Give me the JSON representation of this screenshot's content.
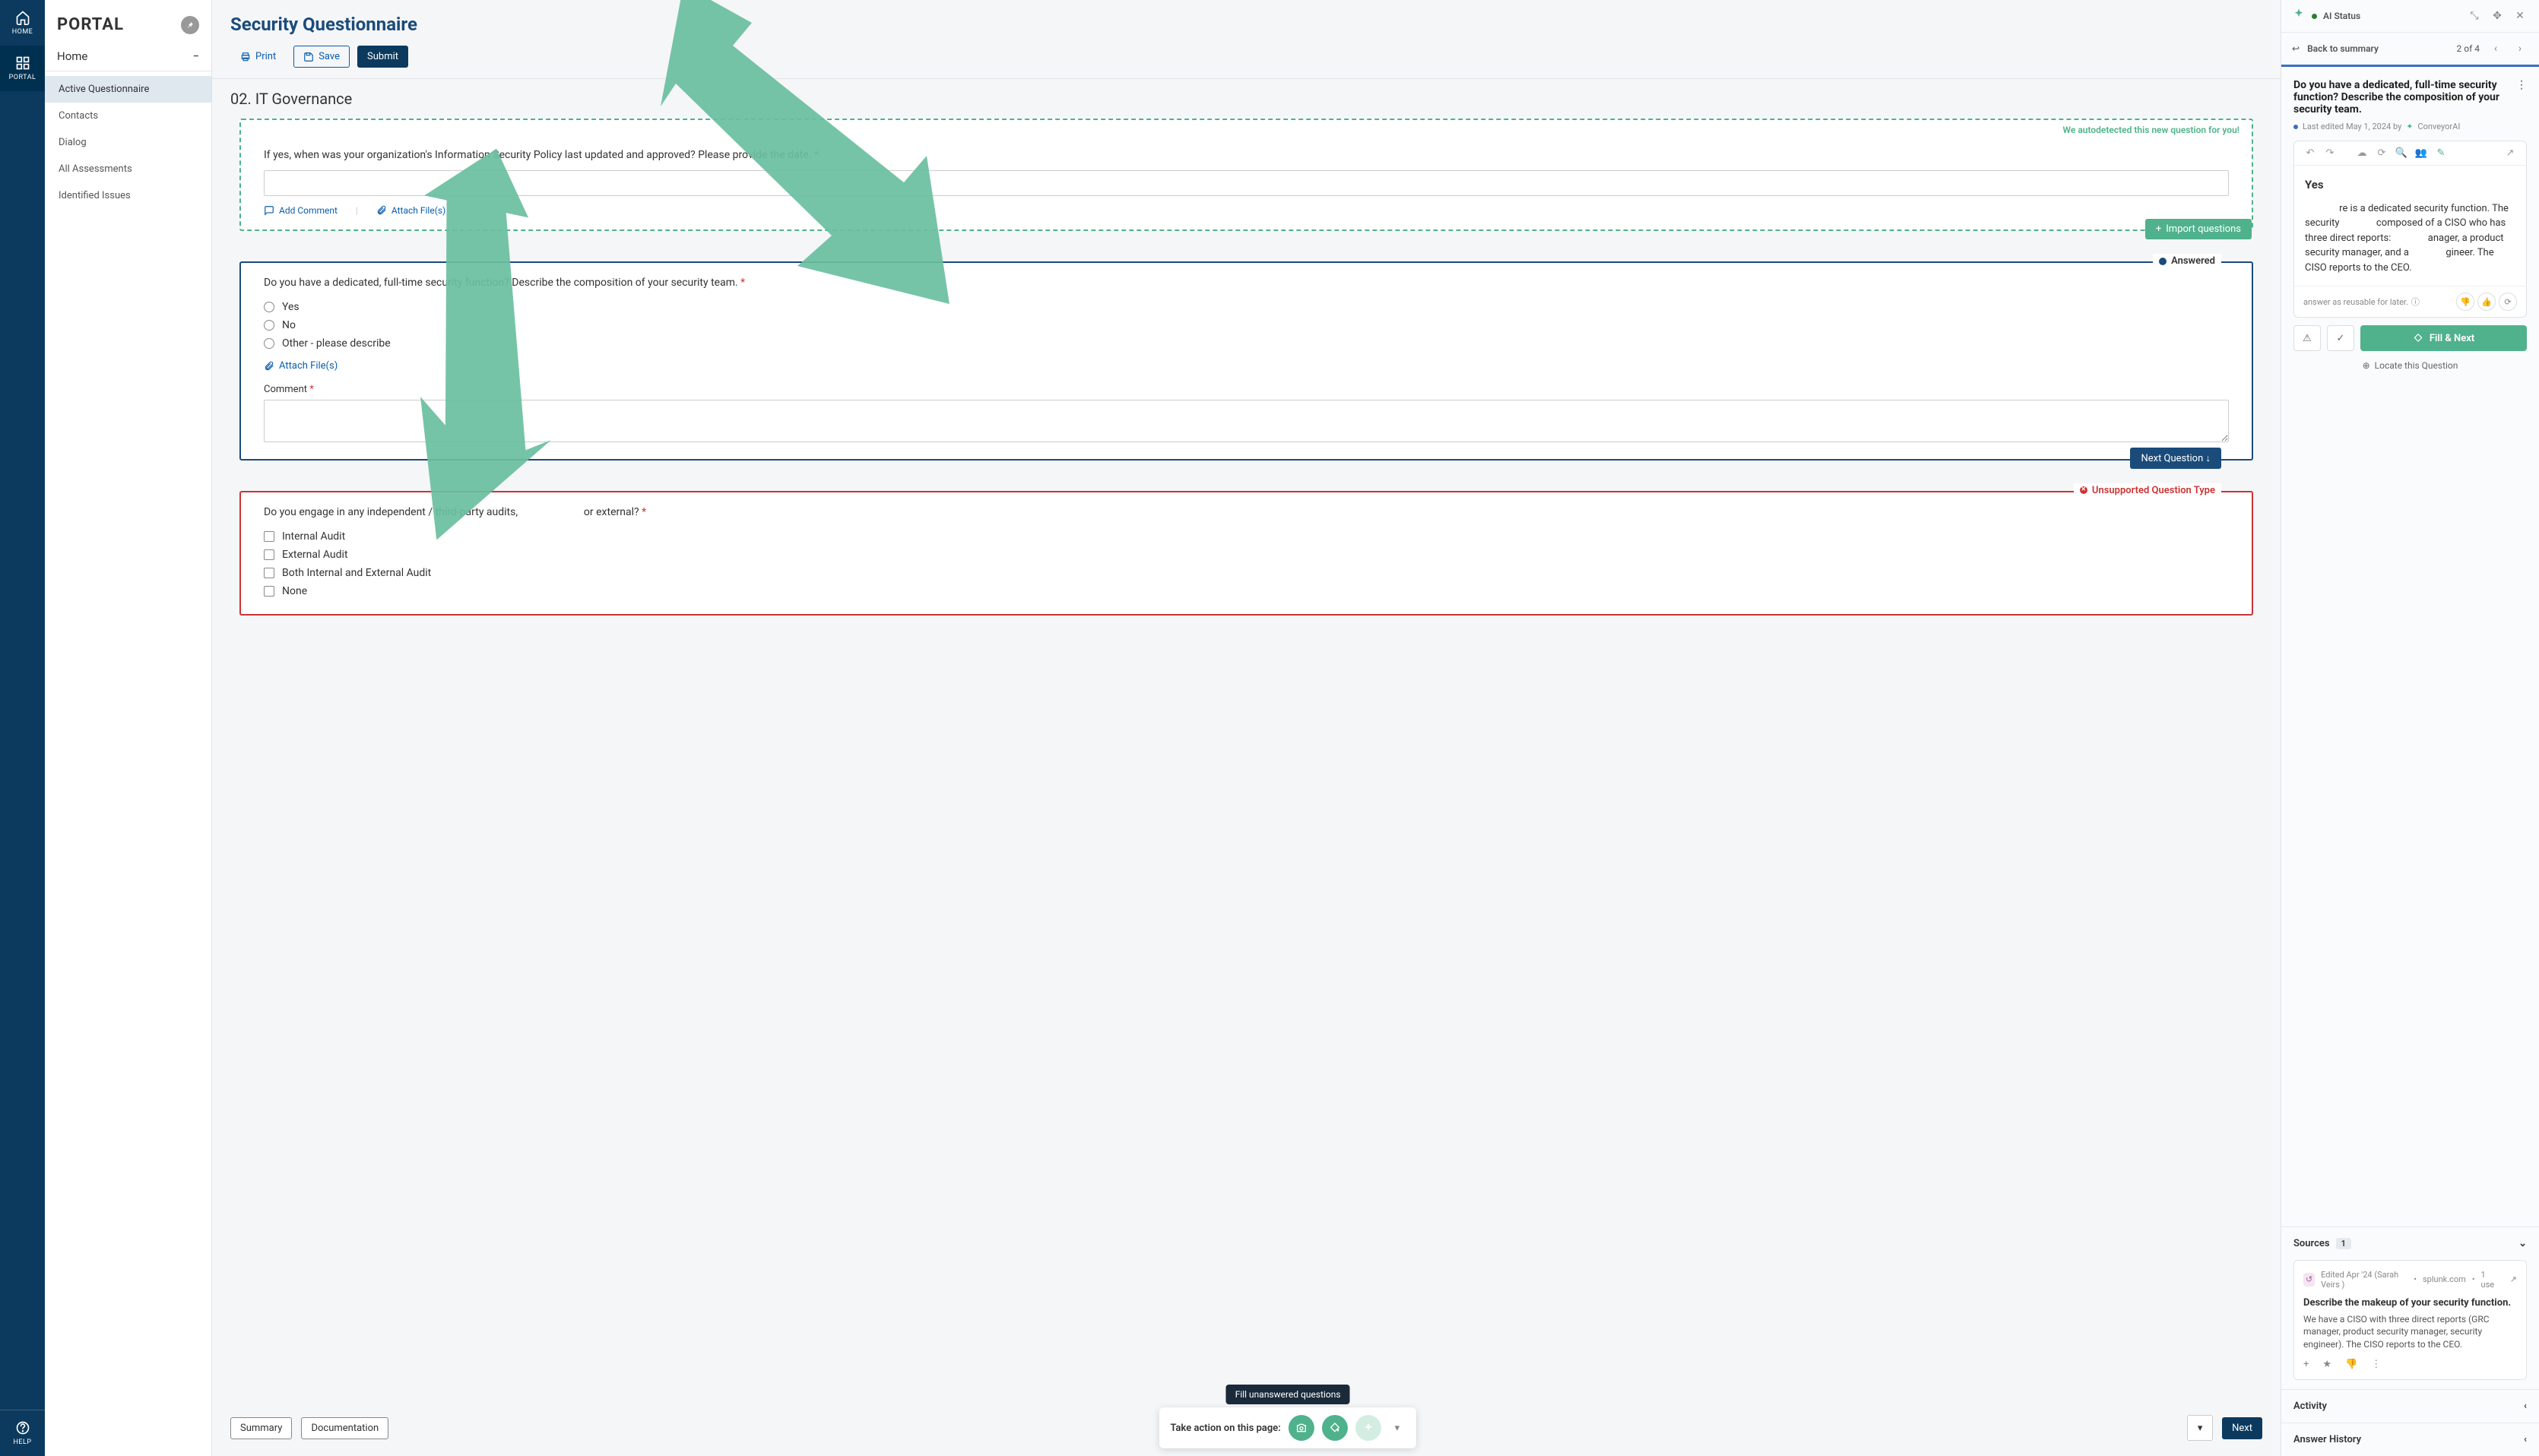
{
  "rail": {
    "home": "HOME",
    "portal": "PORTAL",
    "help": "HELP"
  },
  "sidebar": {
    "title": "PORTAL",
    "home": "Home",
    "items": [
      {
        "label": "Active Questionnaire"
      },
      {
        "label": "Contacts"
      },
      {
        "label": "Dialog"
      },
      {
        "label": "All Assessments"
      },
      {
        "label": "Identified Issues"
      }
    ]
  },
  "header": {
    "title": "Security Questionnaire",
    "print": "Print",
    "save": "Save",
    "submit": "Submit"
  },
  "section": "02. IT Governance",
  "q1": {
    "autodetect": "We autodetected this new question for you!",
    "text": "If yes, when was your organization's Information Security Policy last updated and approved? Please provide the date.",
    "add_comment": "Add Comment",
    "attach": "Attach File(s)",
    "import": "Import questions"
  },
  "q2": {
    "status": "Answered",
    "text": "Do you have a dedicated, full-time security function? Describe the composition of your security team.",
    "opts": [
      "Yes",
      "No",
      "Other - please describe"
    ],
    "attach": "Attach File(s)",
    "comment_label": "Comment",
    "next": "Next Question ↓"
  },
  "q3": {
    "status": "Unsupported Question Type",
    "text": "Do you engage in any independent / third-party audits,                         or external?",
    "opts": [
      "Internal Audit",
      "External Audit",
      "Both Internal and External Audit",
      "None"
    ]
  },
  "bottom": {
    "summary": "Summary",
    "documentation": "Documentation",
    "take_action": "Take action on this page:",
    "tooltip": "Fill unanswered questions",
    "next": "Next"
  },
  "panel": {
    "status": "AI Status",
    "back": "Back to summary",
    "pager": "2 of 4",
    "question": "Do you have a dedicated, full-time security function? Describe the composition of your security team.",
    "edited": "Last edited May 1, 2024 by",
    "edited_by": "ConveyorAI",
    "answer_heading": "Yes",
    "answer_body": "              re is a dedicated security function. The security               composed of a CISO who has three direct reports:               anager, a product security manager, and a               gineer. The CISO reports to the CEO.",
    "reuse": "answer as reusable for later.",
    "fill": "Fill & Next",
    "locate": "Locate this Question",
    "sources": "Sources",
    "sources_count": "1",
    "src_edited": "Edited Apr '24 (Sarah Veirs )",
    "src_domain": "splunk.com",
    "src_uses": "1 use",
    "src_title": "Describe the makeup of your security function.",
    "src_body": "We have a CISO with three direct reports (GRC manager, product security manager, security engineer). The CISO reports to the CEO.",
    "activity": "Activity",
    "history": "Answer History"
  }
}
